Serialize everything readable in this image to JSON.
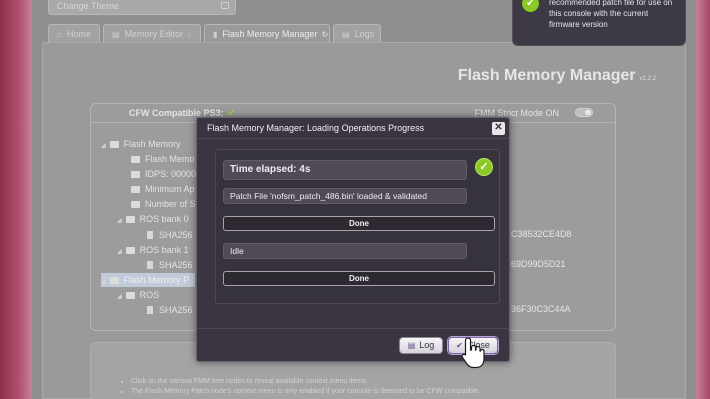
{
  "app": {
    "theme_label": "Change Theme",
    "page_title": "Flash Memory Manager",
    "version": "v1.2.2"
  },
  "tabs": [
    {
      "label": "Home",
      "icon": "home-icon"
    },
    {
      "label": "Memory Editor",
      "icon": "memory-icon"
    },
    {
      "label": "Flash Memory Manager",
      "icon": "flash-icon"
    },
    {
      "label": "Logs",
      "icon": "logs-icon"
    }
  ],
  "tree": {
    "cfw_label": "CFW Compatible PS3:",
    "strict_label": "FMM Strict Mode ON",
    "rows": [
      {
        "label": "Flash Memory",
        "type": "folder",
        "level": 0
      },
      {
        "label": "Flash Memo",
        "type": "folder",
        "level": 1
      },
      {
        "label": "IDPS: 00000",
        "type": "folder",
        "level": 1
      },
      {
        "label": "Minimum Ap",
        "type": "folder",
        "level": 1
      },
      {
        "label": "Number of S",
        "type": "folder",
        "level": 1
      },
      {
        "label": "ROS bank 0",
        "type": "folder",
        "level": 1
      },
      {
        "label": "SHA256",
        "type": "file",
        "level": 2
      },
      {
        "label": "ROS bank 1",
        "type": "folder",
        "level": 1
      },
      {
        "label": "SHA256",
        "type": "file",
        "level": 2
      },
      {
        "label": "Flash Memory P",
        "type": "folder",
        "level": 0,
        "selected": true
      },
      {
        "label": "ROS",
        "type": "folder",
        "level": 1
      },
      {
        "label": "SHA256",
        "type": "file",
        "level": 2
      }
    ],
    "hashes": [
      "C38532CE4D8",
      "69D99D5D21",
      "36F30C3C44A"
    ]
  },
  "help": {
    "items": [
      "Click on the various FMM tree nodes to reveal available context menu items.",
      "The Flash Memory Patch node's context menu is only enabled if your console is detected to be CFW compatible."
    ]
  },
  "notification": {
    "text": "recommended patch file for use on this console with the current firmware version"
  },
  "modal": {
    "title": "Flash Memory Manager: Loading Operations Progress",
    "close_glyph": "✕",
    "time_elapsed": "Time elapsed: 4s",
    "status_1": "Patch File 'nofsm_patch_486.bin' loaded & validated",
    "done_1": "Done",
    "status_2": "Idle",
    "done_2": "Done",
    "log_label": "Log",
    "close_label": "Close"
  },
  "colors": {
    "accent_green": "#8ac926",
    "modal_bg": "#3a3540",
    "button_icon": "#5d4c86"
  }
}
